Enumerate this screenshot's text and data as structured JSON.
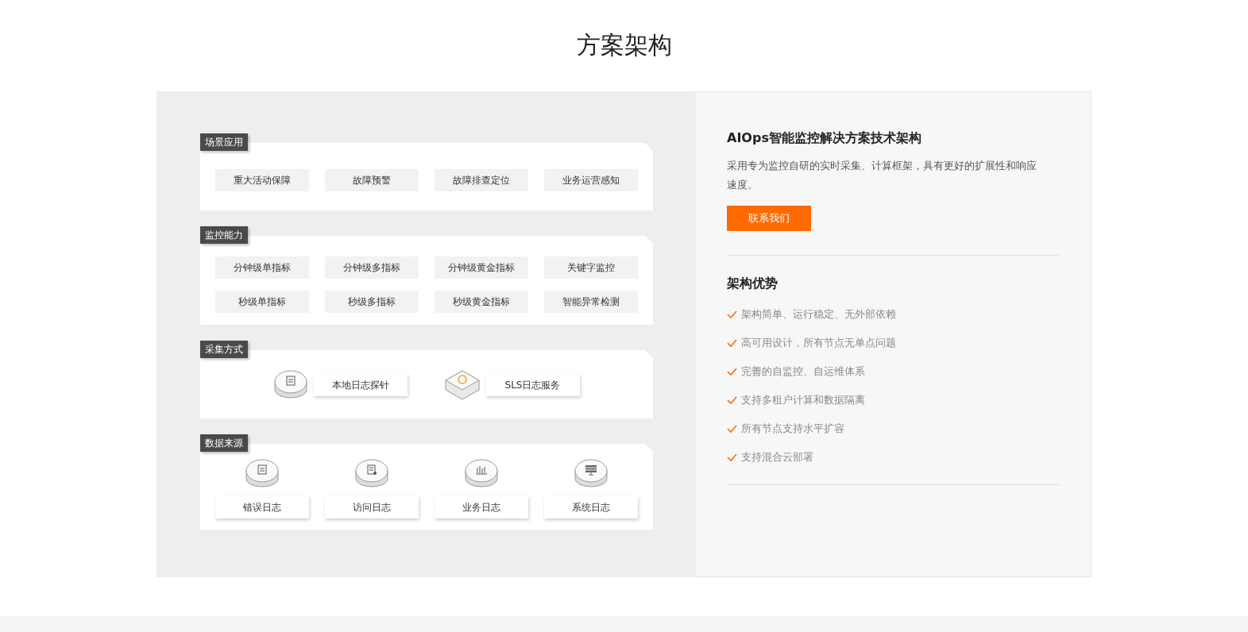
{
  "title": "方案架构",
  "diagram": {
    "sections": [
      {
        "label": "场景应用",
        "kind": "chips",
        "items": [
          "重大活动保障",
          "故障预警",
          "故障排查定位",
          "业务运营感知"
        ]
      },
      {
        "label": "监控能力",
        "kind": "chips",
        "items": [
          "分钟级单指标",
          "分钟级多指标",
          "分钟级黄金指标",
          "关键字监控",
          "秒级单指标",
          "秒级多指标",
          "秒级黄金指标",
          "智能异常检测"
        ]
      },
      {
        "label": "采集方式",
        "kind": "collect",
        "items": [
          "本地日志探针",
          "SLS日志服务"
        ]
      },
      {
        "label": "数据来源",
        "kind": "source",
        "items": [
          "错误日志",
          "访问日志",
          "业务日志",
          "系统日志"
        ]
      }
    ]
  },
  "info": {
    "heading": "AIOps智能监控解决方案技术架构",
    "description": "采用专为监控自研的实时采集、计算框架，具有更好的扩展性和响应速度。",
    "button": "联系我们",
    "advantages_heading": "架构优势",
    "advantages": [
      "架构简单、运行稳定、无外部依赖",
      "高可用设计，所有节点无单点问题",
      "完善的自监控、自运维体系",
      "支持多租户计算和数据隔离",
      "所有节点支持水平扩容",
      "支持混合云部署"
    ]
  }
}
